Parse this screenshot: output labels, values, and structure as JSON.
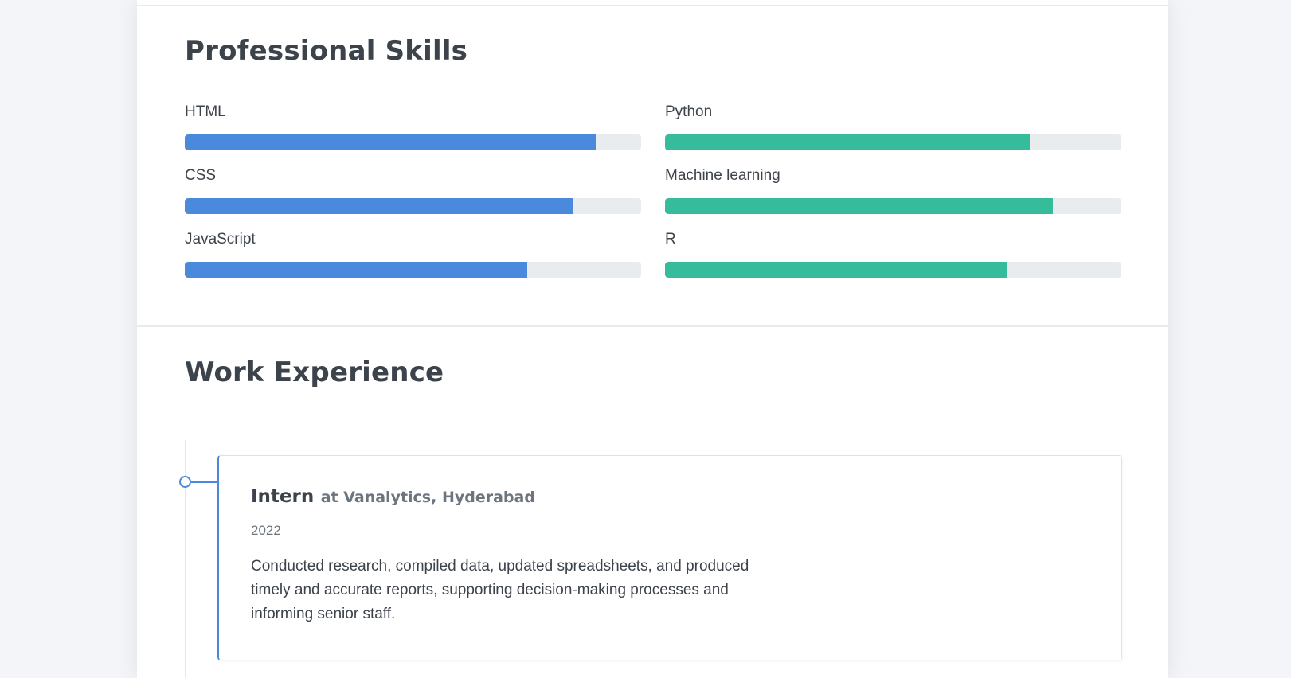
{
  "skills_section": {
    "title": "Professional Skills",
    "colors": {
      "left_bar": "#4a89dc",
      "right_bar": "#37bc9b",
      "track": "#e9ecef"
    },
    "left": [
      {
        "name": "HTML",
        "level": 0.9
      },
      {
        "name": "CSS",
        "level": 0.85
      },
      {
        "name": "JavaScript",
        "level": 0.75
      }
    ],
    "right": [
      {
        "name": "Python",
        "level": 0.8
      },
      {
        "name": "Machine learning",
        "level": 0.85
      },
      {
        "name": "R",
        "level": 0.75
      }
    ]
  },
  "work_section": {
    "title": "Work Experience",
    "jobs": [
      {
        "title": "Intern",
        "company": "at Vanalytics, Hyderabad",
        "year": "2022",
        "description": "Conducted research, compiled data, updated spreadsheets, and produced timely and accurate reports, supporting decision-making processes and informing senior staff."
      }
    ]
  }
}
